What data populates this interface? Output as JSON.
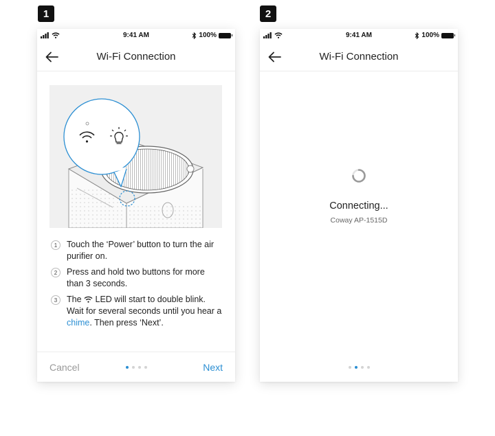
{
  "steps": [
    {
      "badge": "1"
    },
    {
      "badge": "2"
    }
  ],
  "screen1": {
    "status": {
      "time": "9:41 AM",
      "battery": "100%"
    },
    "title": "Wi-Fi Connection",
    "instructions": [
      {
        "num": "1",
        "text": "Touch the ‘Power’ button to turn the air purifier on."
      },
      {
        "num": "2",
        "text": "Press and hold two buttons for more than 3 seconds."
      },
      {
        "num": "3",
        "text_before_icon": "The",
        "text_after_icon": "LED will start to double blink. Wait for several seconds until you hear a",
        "link": "chime",
        "text_end": ". Then press ‘Next’."
      }
    ],
    "cancel_label": "Cancel",
    "next_label": "Next",
    "page_indicator": {
      "count": 4,
      "active": 1
    }
  },
  "screen2": {
    "status": {
      "time": "9:41 AM",
      "battery": "100%"
    },
    "title": "Wi-Fi Connection",
    "connecting_text": "Connecting...",
    "device_name": "Coway AP-1515D",
    "page_indicator": {
      "count": 4,
      "active": 2
    }
  },
  "colors": {
    "accent": "#2c8fd3",
    "badge": "#111111",
    "illustration_bg": "#f0f0f0"
  },
  "icons": [
    "signal-bars-icon",
    "wifi-icon",
    "bluetooth-icon",
    "battery-icon",
    "back-arrow-icon",
    "bulb-icon",
    "spinner-icon"
  ]
}
